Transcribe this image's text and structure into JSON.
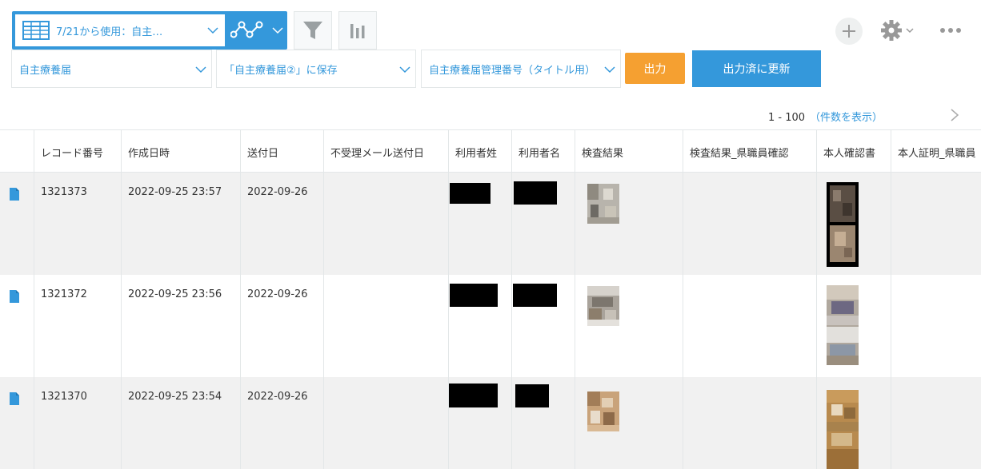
{
  "toolbar": {
    "view_name": "7/21から使用：自主…",
    "view_icon": "table-icon",
    "graph_icon": "graph-icon",
    "filter_icon": "funnel-icon",
    "chart_icon": "bar-chart-icon"
  },
  "actions": {
    "template_select": "自主療養届",
    "save_select": "「自主療養届②」に保存",
    "title_field_select": "自主療養届管理番号（タイトル用）",
    "output_button": "出力",
    "update_button": "出力済に更新"
  },
  "pager": {
    "range": "1 - 100",
    "show_count": "（件数を表示）"
  },
  "columns": [
    "",
    "レコード番号",
    "作成日時",
    "送付日",
    "不受理メール送付日",
    "利用者姓",
    "利用者名",
    "検査結果",
    "検査結果_県職員確認",
    "本人確認書",
    "本人証明_県職員"
  ],
  "rows": [
    {
      "record_no": "1321373",
      "created": "2022-09-25 23:57",
      "sent": "2022-09-26"
    },
    {
      "record_no": "1321372",
      "created": "2022-09-25 23:56",
      "sent": "2022-09-26"
    },
    {
      "record_no": "1321370",
      "created": "2022-09-25 23:54",
      "sent": "2022-09-26"
    }
  ],
  "colors": {
    "accent": "#3498db",
    "orange": "#f5a031",
    "row_alt": "#f1f1f1"
  }
}
